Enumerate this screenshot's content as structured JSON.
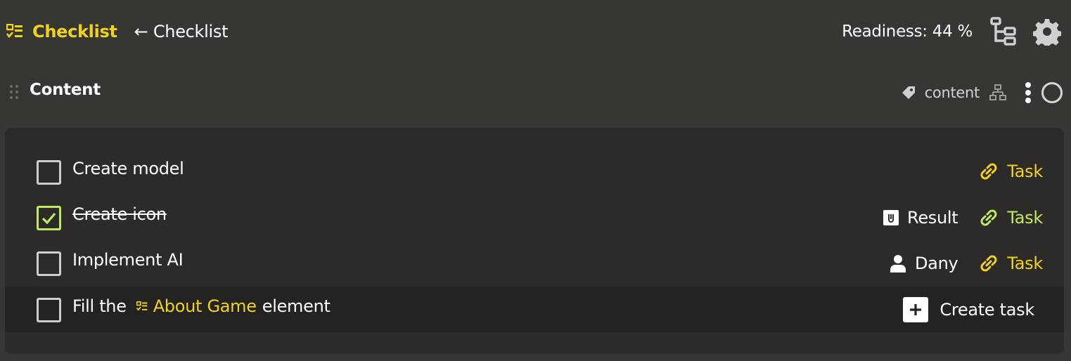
{
  "header": {
    "title": "Checklist",
    "title_icon": "checklist-icon",
    "back_link": "← Checklist",
    "readiness": "Readiness: 44 %",
    "readiness_value": 44,
    "tree_button_icon": "tree-structure-icon",
    "settings_icon": "gear-icon"
  },
  "section": {
    "title": "Content",
    "tag": "content",
    "tag_icon": "tag-icon",
    "hierarchy_icon": "hierarchy-icon",
    "menu_icon": "kebab-menu-icon",
    "status_icon": "status-circle-icon"
  },
  "items": [
    {
      "label": "Create model",
      "checked": false,
      "task_link": "Task",
      "task_color": "#f2d21b"
    },
    {
      "label": "Create icon",
      "checked": true,
      "meta_label": "Result",
      "meta_icon": "attachment-icon",
      "task_link": "Task",
      "task_color": "#c2ea61"
    },
    {
      "label": "Implement AI",
      "checked": false,
      "meta_label": "Dany",
      "meta_icon": "user-icon",
      "task_link": "Task",
      "task_color": "#f2d21b"
    },
    {
      "label_prefix": "Fill the",
      "ref_label": "About Game",
      "label_suffix": "element",
      "checked": false,
      "create_task_label": "Create task"
    }
  ],
  "colors": {
    "accent_yellow": "#f2d21b",
    "done_green": "#c2ea61",
    "background": "#363633",
    "panel": "#2c2b29",
    "row_hover": "#232321"
  }
}
